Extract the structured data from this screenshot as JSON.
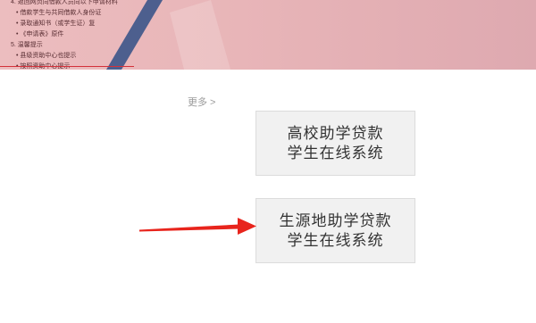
{
  "banner": {
    "colors": {
      "stripe": "#4d5f8e",
      "highlight": "rgba(255,255,255,0.18)",
      "rule": "#d4313a"
    },
    "notice_lines": [
      "4. 返回网页向借款人员向以下申请材料",
      "• 借款学生与共同借款人身份证",
      "• 录取通知书（或学生证）复",
      "• 《申请表》原件",
      "5. 温馨提示",
      "• 县级资助中心也提示",
      "• 按照资助中心提示"
    ]
  },
  "more_link": {
    "label": "更多 >"
  },
  "systems": [
    {
      "line1": "高校助学贷款",
      "line2": "学生在线系统"
    },
    {
      "line1": "生源地助学贷款",
      "line2": "学生在线系统"
    }
  ],
  "annotation": {
    "icon": "red-arrow-icon",
    "color": "#e8241c"
  }
}
